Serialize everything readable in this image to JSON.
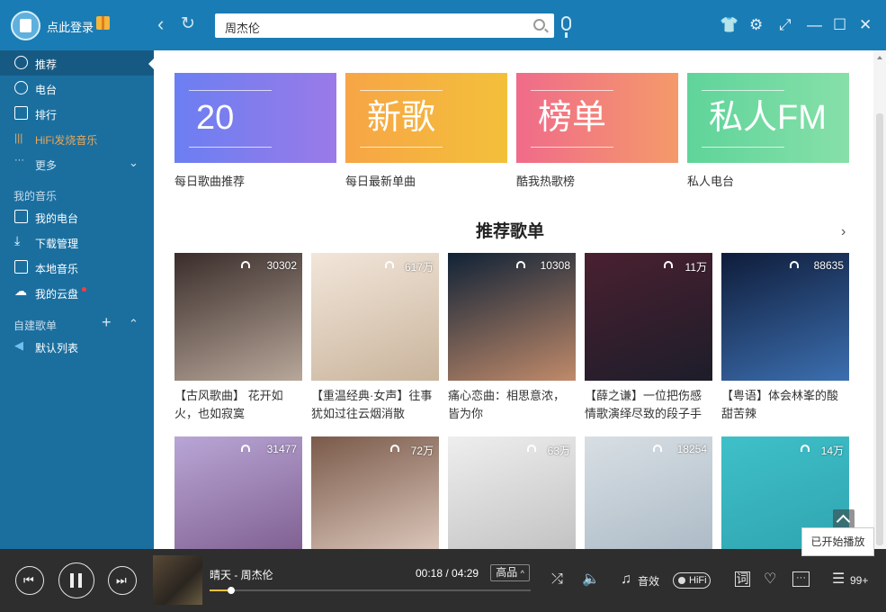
{
  "titlebar": {
    "login_label": "点此登录",
    "search_value": "周杰伦",
    "icons": [
      "skin-icon",
      "settings-icon",
      "mini-mode-icon",
      "minimize-icon",
      "maximize-icon",
      "close-icon"
    ]
  },
  "sidebar": {
    "items": [
      {
        "label": "推荐",
        "icon": "disc-icon"
      },
      {
        "label": "电台",
        "icon": "radio-icon"
      },
      {
        "label": "排行",
        "icon": "chart-icon"
      },
      {
        "label": "HiFi发烧音乐",
        "icon": "waveform-icon"
      },
      {
        "label": "更多",
        "icon": "dots-icon"
      }
    ],
    "my_music_title": "我的音乐",
    "my_music": [
      {
        "label": "我的电台",
        "icon": "radio-box-icon"
      },
      {
        "label": "下载管理",
        "icon": "download-icon"
      },
      {
        "label": "本地音乐",
        "icon": "monitor-icon"
      },
      {
        "label": "我的云盘",
        "icon": "cloud-icon"
      }
    ],
    "playlists_title": "自建歌单",
    "playlists": [
      {
        "label": "默认列表",
        "icon": "speaker-icon"
      }
    ]
  },
  "banners": [
    {
      "big": "20",
      "caption": "每日歌曲推荐",
      "color_from": "#6b7ff2",
      "color_to": "#9a7ae8"
    },
    {
      "big": "新歌",
      "caption": "每日最新单曲",
      "color_from": "#f7a546",
      "color_to": "#f3c03a"
    },
    {
      "big": "榜单",
      "caption": "酷我热歌榜",
      "color_from": "#f06b8a",
      "color_to": "#f49a6a"
    },
    {
      "big": "私人FM",
      "caption": "私人电台",
      "color_from": "#5fd49a",
      "color_to": "#86e0a8"
    }
  ],
  "section": {
    "title": "推荐歌单"
  },
  "playlists_row1": [
    {
      "count": "30302",
      "title": "【古风歌曲】 花开如火，也如寂寞",
      "bg_from": "#3a2d2a",
      "bg_to": "#b8a79a"
    },
    {
      "count": "617万",
      "title": "【重温经典·女声】往事犹如过往云烟消散",
      "bg_from": "#f2e6da",
      "bg_to": "#c9b49c"
    },
    {
      "count": "10308",
      "title": "痛心恋曲：相思意浓，皆为你",
      "bg_from": "#102236",
      "bg_to": "#c08a6a"
    },
    {
      "count": "11万",
      "title": "【薛之谦】一位把伤感情歌演绎尽致的段子手",
      "bg_from": "#4a2030",
      "bg_to": "#1d1d2a"
    },
    {
      "count": "88635",
      "title": "【粤语】体会林峯的酸甜苦辣",
      "bg_from": "#0f1c3a",
      "bg_to": "#3c6fb0"
    }
  ],
  "playlists_row2": [
    {
      "count": "31477",
      "bg_from": "#b9a6d6",
      "bg_to": "#7b5b8c"
    },
    {
      "count": "72万",
      "bg_from": "#7a5a4a",
      "bg_to": "#e4d0c4"
    },
    {
      "count": "63万",
      "bg_from": "#eeeeee",
      "bg_to": "#bfbfbf"
    },
    {
      "count": "18254",
      "bg_from": "#d8dfe4",
      "bg_to": "#a9b8c4"
    },
    {
      "count": "14万",
      "bg_from": "#3fc0c8",
      "bg_to": "#2ea2b0"
    }
  ],
  "player": {
    "song": "晴天 - 周杰伦",
    "current_time": "00:18",
    "separator": " / ",
    "total_time": "04:29",
    "quality": "高品",
    "effect_label": "音效",
    "hifi_label": "HiFi",
    "queue_count": "99+",
    "progress_fraction": 0.067,
    "toast": "已开始播放"
  }
}
